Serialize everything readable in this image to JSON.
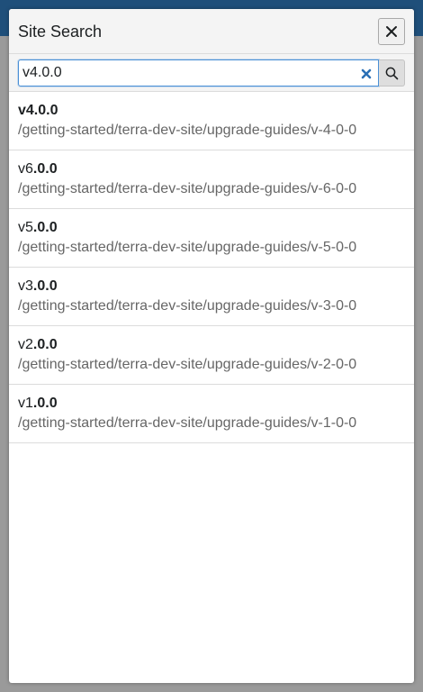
{
  "modal": {
    "title": "Site Search",
    "close_icon": "close-icon"
  },
  "search": {
    "value": "v4.0.0",
    "clear_icon": "clear-x-icon",
    "search_icon": "search-icon"
  },
  "colors": {
    "header_bar": "#1f4f7a",
    "input_focus": "#4a90d6",
    "clear_icon": "#2a6fb5",
    "path_text": "#666666"
  },
  "results": [
    {
      "title_plain": "",
      "title_bold": "v4.0.0",
      "path": "/getting-started/terra-dev-site/upgrade-guides/v-4-0-0"
    },
    {
      "title_plain": "v6",
      "title_bold": ".0.0",
      "path": "/getting-started/terra-dev-site/upgrade-guides/v-6-0-0"
    },
    {
      "title_plain": "v5",
      "title_bold": ".0.0",
      "path": "/getting-started/terra-dev-site/upgrade-guides/v-5-0-0"
    },
    {
      "title_plain": "v3",
      "title_bold": ".0.0",
      "path": "/getting-started/terra-dev-site/upgrade-guides/v-3-0-0"
    },
    {
      "title_plain": "v2",
      "title_bold": ".0.0",
      "path": "/getting-started/terra-dev-site/upgrade-guides/v-2-0-0"
    },
    {
      "title_plain": "v1",
      "title_bold": ".0.0",
      "path": "/getting-started/terra-dev-site/upgrade-guides/v-1-0-0"
    }
  ]
}
